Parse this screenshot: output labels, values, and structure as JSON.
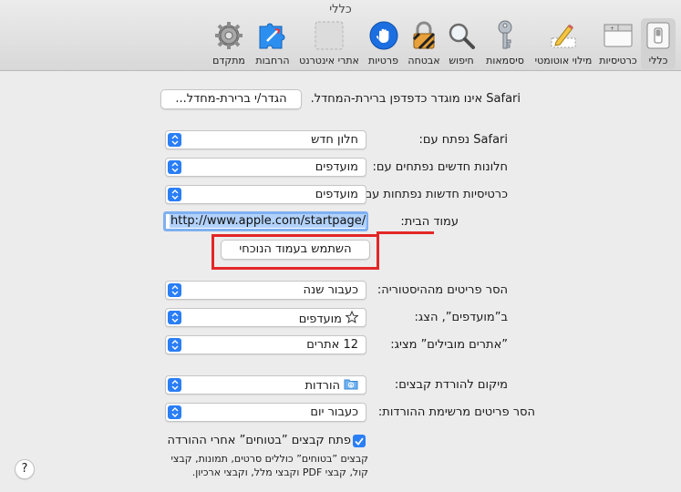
{
  "window": {
    "title": "כללי"
  },
  "toolbar": {
    "tabs": [
      {
        "label": "כללי",
        "icon": "general-switch-icon",
        "active": true
      },
      {
        "label": "כרטיסיות",
        "icon": "tabs-icon",
        "active": false
      },
      {
        "label": "מילוי אוטומטי",
        "icon": "autofill-pencil-icon",
        "active": false
      },
      {
        "label": "סיסמאות",
        "icon": "key-icon",
        "active": false
      },
      {
        "label": "חיפוש",
        "icon": "magnifier-icon",
        "active": false
      },
      {
        "label": "אבטחה",
        "icon": "padlock-icon",
        "active": false
      },
      {
        "label": "פרטיות",
        "icon": "hand-icon",
        "active": false
      },
      {
        "label": "אתרי אינטרנט",
        "icon": "websites-icon",
        "active": false
      },
      {
        "label": "הרחבות",
        "icon": "extensions-puzzle-icon",
        "active": false
      },
      {
        "label": "מתקדם",
        "icon": "gear-icon",
        "active": false
      }
    ]
  },
  "general": {
    "default_browser_text": "Safari אינו מוגדר כדפדפן ברירת-המחדל.",
    "default_browser_button": "הגדר/י ברירת-מחדל...",
    "opens_with_label": "Safari נפתח עם:",
    "opens_with_value": "חלון חדש",
    "new_windows_label": "חלונות חדשים נפתחים עם:",
    "new_windows_value": "מועדפים",
    "new_tabs_label": "כרטיסיות חדשות נפתחות עם:",
    "new_tabs_value": "מועדפים",
    "homepage_label": "עמוד הבית:",
    "homepage_value": "http://www.apple.com/startpage/",
    "use_current_page_button": "השתמש בעמוד הנוכחי",
    "remove_history_label": "הסר פריטים מההיסטוריה:",
    "remove_history_value": "כעבור שנה",
    "favorites_shows_label": "ב”מועדפים”, הצג:",
    "favorites_shows_value": "מועדפים",
    "top_sites_label": "”אתרים מובילים” מציג:",
    "top_sites_value": "12 אתרים",
    "download_location_label": "מיקום להורדת קבצים:",
    "download_location_value": "הורדות",
    "remove_downloads_label": "הסר פריטים מרשימת ההורדות:",
    "remove_downloads_value": "כעבור יום",
    "open_safe_files_label": "פתח קבצים ”בטוחים” אחרי ההורדה",
    "open_safe_files_checked": true,
    "safe_files_note_line1": "קבצים ”בטוחים” כוללים סרטים, תמונות, קבצי",
    "safe_files_note_line2": "קול, קבצי PDF וקבצי מלל, וקבצי ארכיון.",
    "help_button": "?"
  },
  "colors": {
    "accent": "#2a7ef6",
    "highlight": "#e32626",
    "background": "#ececec"
  }
}
